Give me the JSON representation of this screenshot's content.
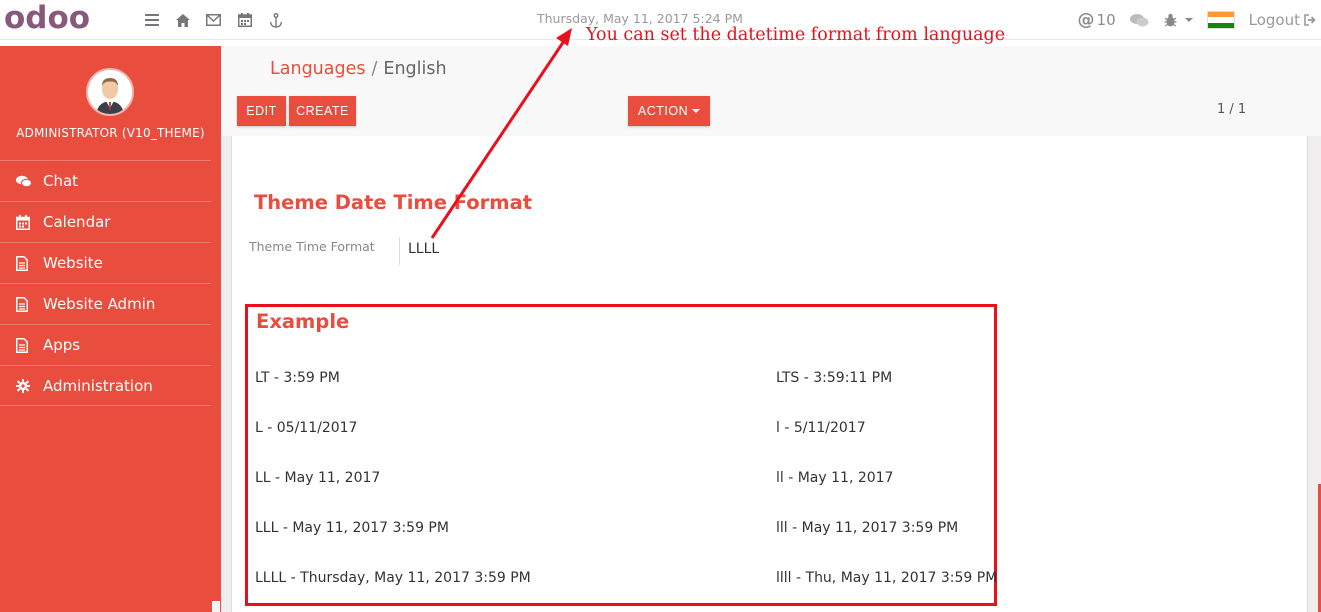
{
  "topbar": {
    "brand": "odoo",
    "datetime": "Thursday, May 11, 2017 5:24 PM",
    "annotation": "You can set the datetime format from language",
    "notification_count": "10",
    "logout_label": "Logout",
    "icons": [
      "menu-icon",
      "home-icon",
      "mail-icon",
      "calendar-icon",
      "anchor-icon"
    ]
  },
  "sidebar": {
    "user_name": "ADMINISTRATOR (V10_THEME)",
    "items": [
      {
        "label": "Chat",
        "icon": "chat-icon"
      },
      {
        "label": "Calendar",
        "icon": "calendar-icon"
      },
      {
        "label": "Website",
        "icon": "document-icon"
      },
      {
        "label": "Website Admin",
        "icon": "document-icon"
      },
      {
        "label": "Apps",
        "icon": "document-icon"
      },
      {
        "label": "Administration",
        "icon": "gear-icon"
      }
    ]
  },
  "control_panel": {
    "breadcrumb_parent": "Languages",
    "breadcrumb_sep": "/",
    "breadcrumb_current": "English",
    "edit_label": "EDIT",
    "create_label": "CREATE",
    "action_label": "ACTION",
    "pager": "1 / 1"
  },
  "form": {
    "section_title": "Theme Date Time Format",
    "field_label": "Theme Time Format",
    "field_value": "LLLL",
    "example_title": "Example",
    "examples_left": [
      "LT - 3:59 PM",
      "L - 05/11/2017",
      "LL - May 11, 2017",
      "LLL - May 11, 2017 3:59 PM",
      "LLLL - Thursday, May 11, 2017 3:59 PM"
    ],
    "examples_right": [
      "LTS - 3:59:11 PM",
      "l - 5/11/2017",
      "ll - May 11, 2017",
      "lll - May 11, 2017 3:59 PM",
      "llll - Thu, May 11, 2017 3:59 PM"
    ]
  },
  "colors": {
    "brand": "#875a7b",
    "accent": "#e94d3e",
    "annotation": "#e8101b"
  }
}
